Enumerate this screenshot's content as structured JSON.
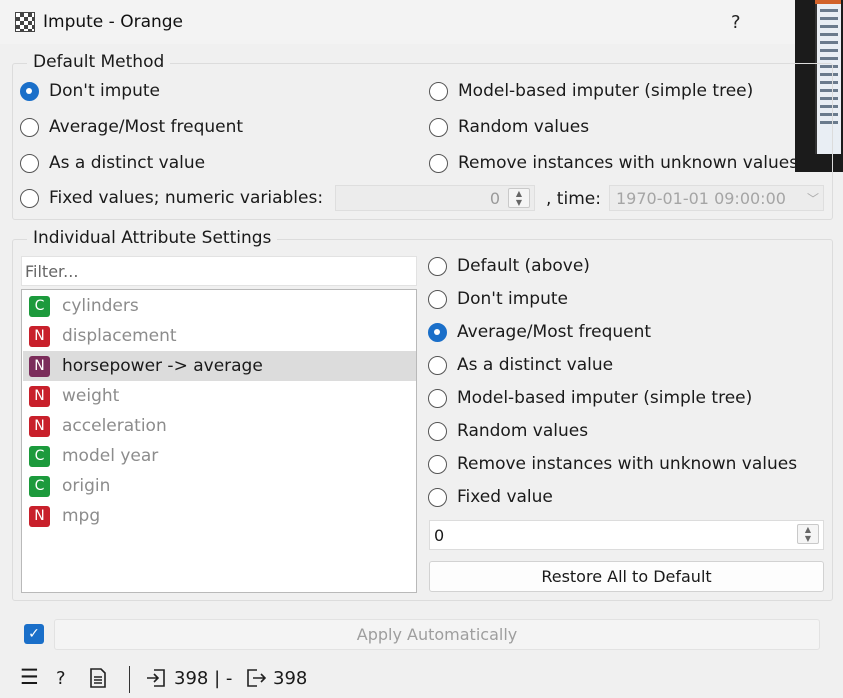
{
  "window": {
    "title": "Impute - Orange",
    "help_label": "?"
  },
  "default_method": {
    "title": "Default Method",
    "options": [
      {
        "label": "Don't impute",
        "checked": true
      },
      {
        "label": "Average/Most frequent",
        "checked": false
      },
      {
        "label": "As a distinct value",
        "checked": false
      },
      {
        "label": "Fixed values; numeric variables:",
        "checked": false
      },
      {
        "label": "Model-based imputer (simple tree)",
        "checked": false
      },
      {
        "label": "Random values",
        "checked": false
      },
      {
        "label": "Remove instances with unknown values",
        "checked": false
      }
    ],
    "numeric_value": "0",
    "time_label": ", time:",
    "time_value": "1970-01-01 09:00:00"
  },
  "individual": {
    "title": "Individual Attribute Settings",
    "filter_placeholder": "Filter...",
    "attributes": [
      {
        "type": "C",
        "name": "cylinders",
        "selected": false
      },
      {
        "type": "N",
        "name": "displacement",
        "selected": false
      },
      {
        "type": "N",
        "name": "horsepower -> average",
        "selected": true
      },
      {
        "type": "N",
        "name": "weight",
        "selected": false
      },
      {
        "type": "N",
        "name": "acceleration",
        "selected": false
      },
      {
        "type": "C",
        "name": "model year",
        "selected": false
      },
      {
        "type": "C",
        "name": "origin",
        "selected": false
      },
      {
        "type": "N",
        "name": "mpg",
        "selected": false
      }
    ],
    "options": [
      {
        "label": "Default (above)",
        "checked": false
      },
      {
        "label": "Don't impute",
        "checked": false
      },
      {
        "label": "Average/Most frequent",
        "checked": true
      },
      {
        "label": "As a distinct value",
        "checked": false
      },
      {
        "label": "Model-based imputer (simple tree)",
        "checked": false
      },
      {
        "label": "Random values",
        "checked": false
      },
      {
        "label": "Remove instances with unknown values",
        "checked": false
      },
      {
        "label": "Fixed value",
        "checked": false
      }
    ],
    "fixed_value": "0",
    "restore_label": "Restore All to Default"
  },
  "apply": {
    "label": "Apply Automatically",
    "auto": true
  },
  "status": {
    "input_count": "398 | -",
    "output_count": "398"
  },
  "colors": {
    "accent": "#1a6fc9",
    "continuous": "#1c9a3c",
    "numeric": "#c8202b",
    "selected_badge": "#7b2d5b"
  }
}
